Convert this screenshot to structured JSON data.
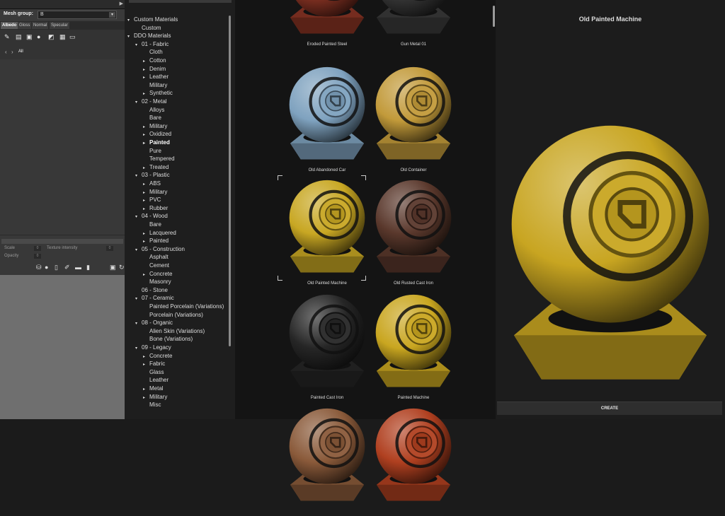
{
  "left_panel": {
    "mesh_group_label": "Mesh group:",
    "mesh_group_value": "B",
    "tabs": [
      "Albedo",
      "Gloss",
      "Normal",
      "Specular"
    ],
    "nav_all": "All",
    "props": {
      "scale_label": "Scale",
      "scale_value": "0",
      "texture_intensity_label": "Texture intensity",
      "texture_intensity_value": "0",
      "opacity_label": "Opacity",
      "opacity_value": "0"
    }
  },
  "tree": [
    {
      "label": "Custom Materials",
      "arrow": "▾"
    },
    {
      "label": "Custom",
      "arrow": ""
    },
    {
      "label": "DDO Materials",
      "arrow": "▾"
    },
    {
      "label": "01 - Fabric",
      "arrow": "▾"
    },
    {
      "label": "Cloth",
      "arrow": ""
    },
    {
      "label": "Cotton",
      "arrow": "▸"
    },
    {
      "label": "Denim",
      "arrow": "▸"
    },
    {
      "label": "Leather",
      "arrow": "▸"
    },
    {
      "label": "Military",
      "arrow": ""
    },
    {
      "label": "Synthetic",
      "arrow": "▸"
    },
    {
      "label": "02 - Metal",
      "arrow": "▾"
    },
    {
      "label": "Alloys",
      "arrow": ""
    },
    {
      "label": "Bare",
      "arrow": ""
    },
    {
      "label": "Military",
      "arrow": "▸"
    },
    {
      "label": "Oxidized",
      "arrow": "▸"
    },
    {
      "label": "Painted",
      "arrow": "▸"
    },
    {
      "label": "Pure",
      "arrow": ""
    },
    {
      "label": "Tempered",
      "arrow": ""
    },
    {
      "label": "Treated",
      "arrow": "▸"
    },
    {
      "label": "03 - Plastic",
      "arrow": "▾"
    },
    {
      "label": "ABS",
      "arrow": "▸"
    },
    {
      "label": "Military",
      "arrow": "▸"
    },
    {
      "label": "PVC",
      "arrow": "▸"
    },
    {
      "label": "Rubber",
      "arrow": "▸"
    },
    {
      "label": "04 - Wood",
      "arrow": "▾"
    },
    {
      "label": "Bare",
      "arrow": ""
    },
    {
      "label": "Lacquered",
      "arrow": "▸"
    },
    {
      "label": "Painted",
      "arrow": "▸"
    },
    {
      "label": "05 - Construction",
      "arrow": "▾"
    },
    {
      "label": "Asphalt",
      "arrow": ""
    },
    {
      "label": "Cement",
      "arrow": ""
    },
    {
      "label": "Concrete",
      "arrow": "▸"
    },
    {
      "label": "Masonry",
      "arrow": ""
    },
    {
      "label": "06 - Stone",
      "arrow": ""
    },
    {
      "label": "07 - Ceramic",
      "arrow": "▾"
    },
    {
      "label": "Painted Porcelain (Variations)",
      "arrow": ""
    },
    {
      "label": "Porcelain (Variations)",
      "arrow": ""
    },
    {
      "label": "08 - Organic",
      "arrow": "▾"
    },
    {
      "label": "Alien Skin (Variations)",
      "arrow": ""
    },
    {
      "label": "Bone (Variations)",
      "arrow": ""
    },
    {
      "label": "09 - Legacy",
      "arrow": "▾"
    },
    {
      "label": "Concrete",
      "arrow": "▸"
    },
    {
      "label": "Fabric",
      "arrow": "▸"
    },
    {
      "label": "Glass",
      "arrow": ""
    },
    {
      "label": "Leather",
      "arrow": ""
    },
    {
      "label": "Metal",
      "arrow": "▸"
    },
    {
      "label": "Military",
      "arrow": "▸"
    },
    {
      "label": "Misc",
      "arrow": ""
    }
  ],
  "materials": [
    {
      "name": "Eroded Painted Steel",
      "color": "#8a3424"
    },
    {
      "name": "Gun Metal 01",
      "color": "#3a3a3a"
    },
    {
      "name": "Old Abandoned Car",
      "color": "#7fa2bf"
    },
    {
      "name": "Old Container",
      "color": "#c29a3a"
    },
    {
      "name": "Old Painted Machine",
      "color": "#c8a723"
    },
    {
      "name": "Old Rusted Cast Iron",
      "color": "#5a382c"
    },
    {
      "name": "Painted Cast Iron",
      "color": "#262626"
    },
    {
      "name": "Painted Machine",
      "color": "#c9a620"
    },
    {
      "name": "",
      "color": "#8a5a3a"
    },
    {
      "name": "",
      "color": "#b04020"
    }
  ],
  "preview": {
    "title": "Old Painted Machine",
    "create_label": "CREATE",
    "color": "#c8a521"
  }
}
